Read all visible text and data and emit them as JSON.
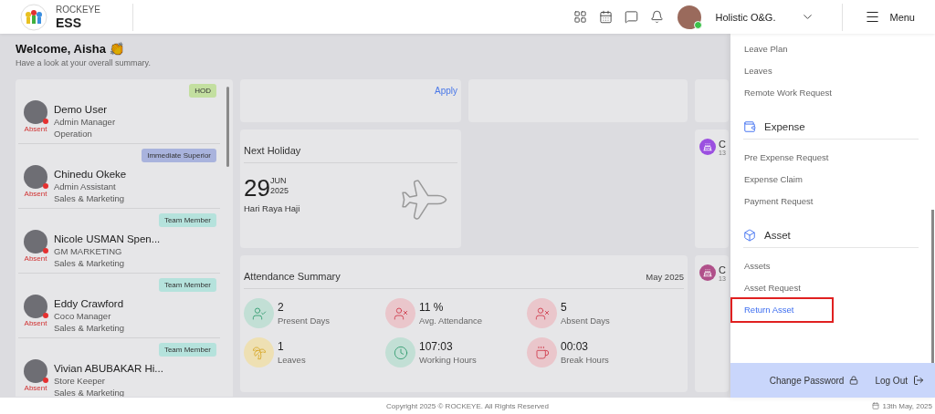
{
  "header": {
    "brand_top": "ROCKEYE",
    "brand_bottom": "ESS",
    "company": "Holistic O&G.",
    "menu_label": "Menu",
    "user": {
      "online": true
    }
  },
  "welcome": {
    "title": "Welcome, Aisha",
    "emoji": "👏",
    "subtitle": "Have a look at your overall summary."
  },
  "people": [
    {
      "name": "Demo User",
      "role": "Admin Manager",
      "department": "Operation",
      "status": "Absent",
      "badge": {
        "label": "HOD",
        "color": "#c3dfa0"
      }
    },
    {
      "name": "Chinedu Okeke",
      "role": "Admin Assistant",
      "department": "Sales & Marketing",
      "status": "Absent",
      "badge": {
        "label": "Immediate Superior",
        "color": "#a9b3dd"
      }
    },
    {
      "name": "Nicole USMAN Spen...",
      "role": "GM MARKETING",
      "department": "Sales & Marketing",
      "status": "Absent",
      "badge": {
        "label": "Team Member",
        "color": "#b5e2dc"
      }
    },
    {
      "name": "Eddy Crawford",
      "role": "Coco Manager",
      "department": "Sales & Marketing",
      "status": "Absent",
      "badge": {
        "label": "Team Member",
        "color": "#b5e2dc"
      }
    },
    {
      "name": "Vivian ABUBAKAR Hi...",
      "role": "Store Keeper",
      "department": "Sales & Marketing",
      "status": "Absent",
      "badge": {
        "label": "Team Member",
        "color": "#b5e2dc"
      }
    }
  ],
  "apply_link": "Apply",
  "next_holiday": {
    "title": "Next Holiday",
    "day": "29",
    "month": "JUN",
    "year": "2025",
    "name": "Hari Raya Haji"
  },
  "attendance": {
    "title": "Attendance Summary",
    "period": "May 2025",
    "stats": [
      {
        "kind": "present",
        "value": "2",
        "label": "Present Days",
        "color": "#c2dfd5"
      },
      {
        "kind": "avg",
        "value": "11 %",
        "label": "Avg. Attendance",
        "color": "#eac6cb"
      },
      {
        "kind": "absent",
        "value": "5",
        "label": "Absent Days",
        "color": "#eac6cb"
      },
      {
        "kind": "leaves",
        "value": "1",
        "label": "Leaves",
        "color": "#eee0b3"
      },
      {
        "kind": "working",
        "value": "107:03",
        "label": "Working Hours",
        "color": "#c2dfd5"
      },
      {
        "kind": "break",
        "value": "00:03",
        "label": "Break Hours",
        "color": "#eac6cb"
      }
    ]
  },
  "side_cards": [
    {
      "initial": "C",
      "date": "13",
      "color": "#9b4fe0"
    },
    {
      "initial": "C",
      "date": "13",
      "color": "#b0508a"
    }
  ],
  "menu": {
    "sections": [
      {
        "items": [
          {
            "label": "Leave Plan",
            "selected": false
          },
          {
            "label": "Leaves",
            "selected": false
          },
          {
            "label": "Remote Work Request",
            "selected": false
          }
        ]
      },
      {
        "title": "Expense",
        "kind": "expense",
        "items": [
          {
            "label": "Pre Expense Request",
            "selected": false
          },
          {
            "label": "Expense Claim",
            "selected": false
          },
          {
            "label": "Payment Request",
            "selected": false
          }
        ]
      },
      {
        "title": "Asset",
        "kind": "asset",
        "items": [
          {
            "label": "Assets",
            "selected": false
          },
          {
            "label": "Asset Request",
            "selected": false
          },
          {
            "label": "Return Asset",
            "selected": true
          }
        ]
      }
    ],
    "change_password": "Change Password",
    "logout": "Log Out"
  },
  "footer": {
    "copyright": "Copyright 2025 © ROCKEYE. All Rights Reserved",
    "date": "13th May, 2025"
  }
}
